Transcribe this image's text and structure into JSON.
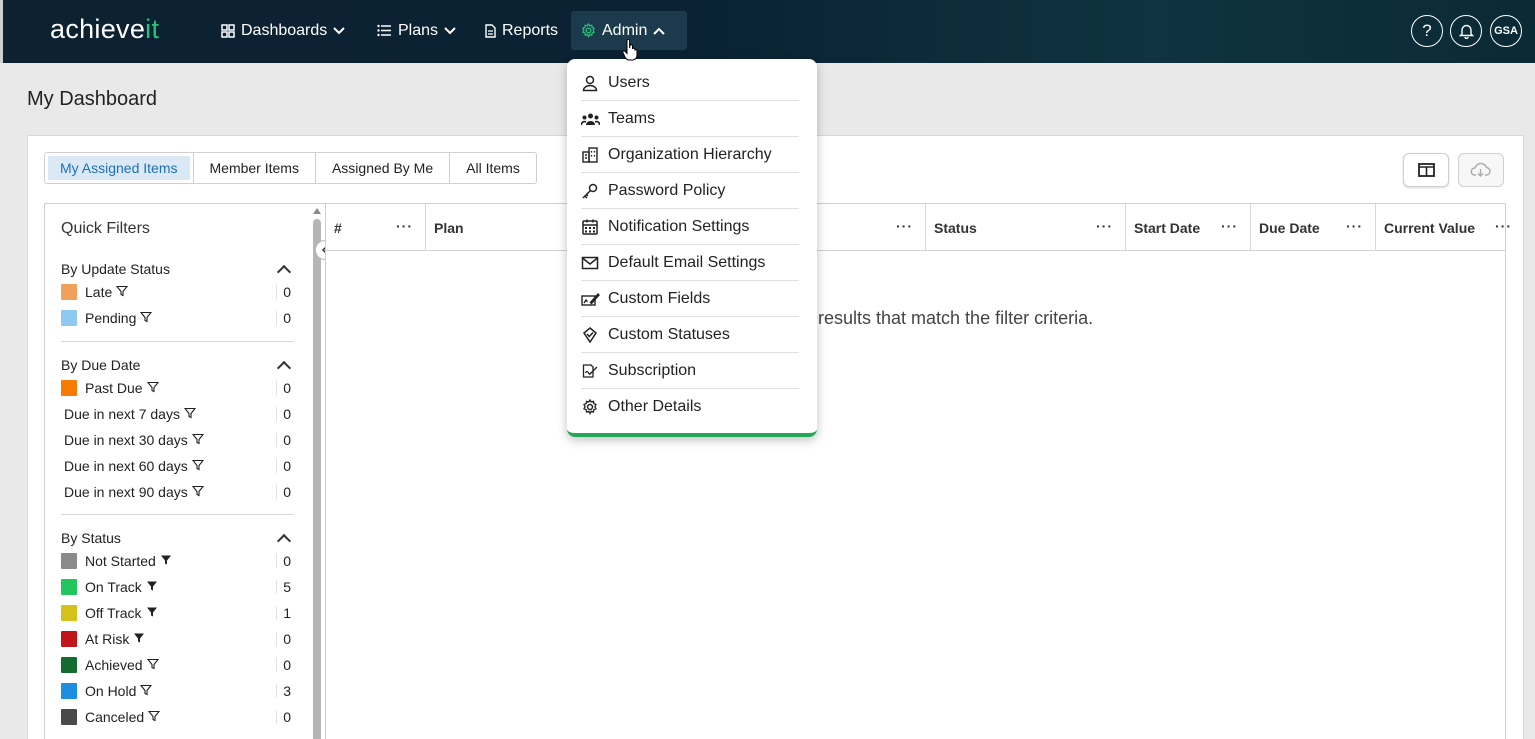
{
  "nav": {
    "logo_main": "achieve",
    "logo_accent": "it",
    "dashboards_label": "Dashboards",
    "plans_label": "Plans",
    "reports_label": "Reports",
    "admin_label": "Admin",
    "help_label": "?",
    "avatar_initials": "GSA"
  },
  "page": {
    "title": "My Dashboard"
  },
  "tabs": [
    "My Assigned Items",
    "Member Items",
    "Assigned By Me",
    "All Items"
  ],
  "quick_filters": {
    "title": "Quick Filters",
    "update_status": {
      "heading": "By Update Status",
      "items": [
        {
          "label": "Late",
          "count": "0",
          "color": "#f0a05a"
        },
        {
          "label": "Pending",
          "count": "0",
          "color": "#8ec9f0"
        }
      ]
    },
    "due_date": {
      "heading": "By Due Date",
      "items": [
        {
          "label": "Past Due",
          "count": "0",
          "color": "#f57c00"
        },
        {
          "label": "Due in next 7 days",
          "count": "0"
        },
        {
          "label": "Due in next 30 days",
          "count": "0"
        },
        {
          "label": "Due in next 60 days",
          "count": "0"
        },
        {
          "label": "Due in next 90 days",
          "count": "0"
        }
      ]
    },
    "status": {
      "heading": "By Status",
      "items": [
        {
          "label": "Not Started",
          "count": "0",
          "color": "#8a8a8a"
        },
        {
          "label": "On Track",
          "count": "5",
          "color": "#22c55e"
        },
        {
          "label": "Off Track",
          "count": "1",
          "color": "#d4c21a"
        },
        {
          "label": "At Risk",
          "count": "0",
          "color": "#c0161b"
        },
        {
          "label": "Achieved",
          "count": "0",
          "color": "#156b2f"
        },
        {
          "label": "On Hold",
          "count": "3",
          "color": "#1e8fe0"
        },
        {
          "label": "Canceled",
          "count": "0",
          "color": "#4a4a4a"
        }
      ]
    }
  },
  "grid": {
    "columns": [
      "#",
      "Plan",
      "Status",
      "Start Date",
      "Due Date",
      "Current Value"
    ],
    "empty_message": "results that match the filter criteria."
  },
  "admin_menu": {
    "items": [
      {
        "label": "Users",
        "icon": "user-icon"
      },
      {
        "label": "Teams",
        "icon": "teams-icon"
      },
      {
        "label": "Organization Hierarchy",
        "icon": "building-icon"
      },
      {
        "label": "Password Policy",
        "icon": "key-icon"
      },
      {
        "label": "Notification Settings",
        "icon": "calendar-icon"
      },
      {
        "label": "Default Email Settings",
        "icon": "envelope-icon"
      },
      {
        "label": "Custom Fields",
        "icon": "custom-fields-icon"
      },
      {
        "label": "Custom Statuses",
        "icon": "tag-icon"
      },
      {
        "label": "Subscription",
        "icon": "subscription-icon"
      },
      {
        "label": "Other Details",
        "icon": "gear-icon"
      }
    ]
  }
}
